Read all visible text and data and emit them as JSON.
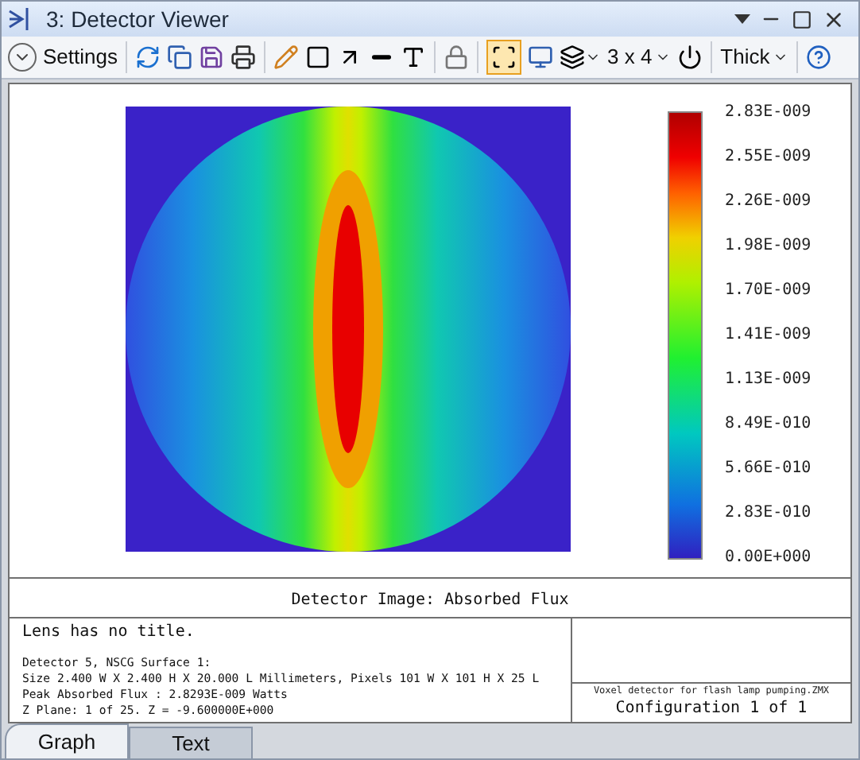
{
  "window": {
    "title": "3: Detector Viewer"
  },
  "toolbar": {
    "settings": "Settings",
    "layout": "3 x 4",
    "line_style": "Thick"
  },
  "plot": {
    "colorbar_labels": [
      "2.83E-009",
      "2.55E-009",
      "2.26E-009",
      "1.98E-009",
      "1.70E-009",
      "1.41E-009",
      "1.13E-009",
      "8.49E-010",
      "5.66E-010",
      "2.83E-010",
      "0.00E+000"
    ],
    "caption": "Detector Image: Absorbed Flux"
  },
  "info": {
    "title": "Lens has no title.",
    "lines": [
      "Detector 5, NSCG Surface 1:",
      "Size 2.400 W X 2.400 H X 20.000 L Millimeters, Pixels 101 W X 101 H X 25 L",
      "Peak Absorbed Flux : 2.8293E-009 Watts",
      "Z Plane: 1 of 25. Z = -9.600000E+000"
    ],
    "file": "Voxel detector for flash lamp pumping.ZMX",
    "configuration": "Configuration 1 of 1"
  },
  "tabs": [
    {
      "label": "Graph",
      "selected": true
    },
    {
      "label": "Text",
      "selected": false
    }
  ]
}
